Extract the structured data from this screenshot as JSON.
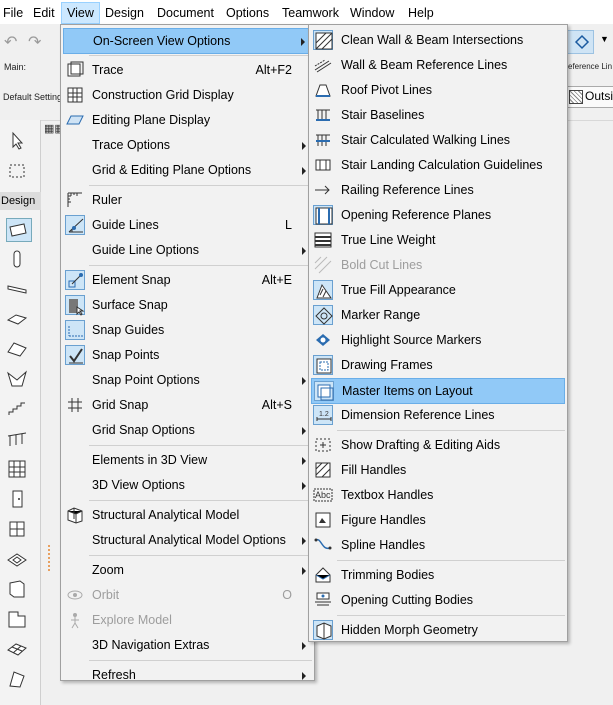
{
  "menubar": [
    "File",
    "Edit",
    "View",
    "Design",
    "Document",
    "Options",
    "Teamwork",
    "Window",
    "Help"
  ],
  "toolbar": {
    "main_label": "Main:",
    "default_settings": "Default Setting",
    "right_label": "eference Lin",
    "outside_label": "Outsi"
  },
  "toolbox": {
    "design_tab": "Design"
  },
  "view_menu": [
    {
      "label": "On-Screen View Options",
      "submenu": true,
      "highlighted": true
    },
    {
      "sep": true
    },
    {
      "label": "Trace",
      "shortcut": "Alt+F2",
      "icon": "trace-icon"
    },
    {
      "label": "Construction Grid Display",
      "icon": "grid-icon"
    },
    {
      "label": "Editing Plane Display",
      "icon": "editing-plane-icon"
    },
    {
      "label": "Trace Options",
      "submenu": true
    },
    {
      "label": "Grid & Editing Plane Options",
      "submenu": true
    },
    {
      "sep": true
    },
    {
      "label": "Ruler",
      "icon": "ruler-icon"
    },
    {
      "label": "Guide Lines",
      "shortcut": "L",
      "icon": "guide-lines-icon",
      "checked": true
    },
    {
      "label": "Guide Line Options",
      "submenu": true
    },
    {
      "sep": true
    },
    {
      "label": "Element Snap",
      "shortcut": "Alt+E",
      "icon": "element-snap-icon",
      "checked": true
    },
    {
      "label": "Surface Snap",
      "icon": "surface-snap-icon",
      "checked": true
    },
    {
      "label": "Snap Guides",
      "icon": "snap-guides-icon",
      "checked": true
    },
    {
      "label": "Snap Points",
      "icon": "snap-points-icon",
      "checked": true
    },
    {
      "label": "Snap Point Options",
      "submenu": true
    },
    {
      "label": "Grid Snap",
      "shortcut": "Alt+S",
      "icon": "grid-snap-icon"
    },
    {
      "label": "Grid Snap Options",
      "submenu": true
    },
    {
      "sep": true
    },
    {
      "label": "Elements in 3D View",
      "submenu": true
    },
    {
      "label": "3D View Options",
      "submenu": true
    },
    {
      "sep": true
    },
    {
      "label": "Structural Analytical Model",
      "icon": "structural-model-icon"
    },
    {
      "label": "Structural Analytical Model Options",
      "submenu": true
    },
    {
      "sep": true
    },
    {
      "label": "Zoom",
      "submenu": true
    },
    {
      "label": "Orbit",
      "shortcut": "O",
      "icon": "orbit-icon",
      "disabled": true
    },
    {
      "label": "Explore Model",
      "icon": "explore-icon",
      "disabled": true
    },
    {
      "label": "3D Navigation Extras",
      "submenu": true
    },
    {
      "sep": true
    },
    {
      "label": "Refresh",
      "submenu": true
    }
  ],
  "submenu": [
    {
      "label": "Clean Wall & Beam Intersections",
      "icon": "clean-intersections-icon",
      "checked": true
    },
    {
      "label": "Wall & Beam Reference Lines",
      "icon": "reference-lines-icon"
    },
    {
      "label": "Roof Pivot Lines",
      "icon": "roof-pivot-icon"
    },
    {
      "label": "Stair Baselines",
      "icon": "stair-baselines-icon"
    },
    {
      "label": "Stair Calculated Walking Lines",
      "icon": "walking-lines-icon"
    },
    {
      "label": "Stair Landing Calculation Guidelines",
      "icon": "landing-guidelines-icon"
    },
    {
      "label": "Railing Reference Lines",
      "icon": "railing-lines-icon"
    },
    {
      "label": "Opening Reference Planes",
      "icon": "opening-planes-icon",
      "checked": true
    },
    {
      "label": "True Line Weight",
      "icon": "line-weight-icon"
    },
    {
      "label": "Bold Cut Lines",
      "icon": "bold-cut-icon",
      "disabled": true
    },
    {
      "label": "True Fill Appearance",
      "icon": "fill-appearance-icon",
      "checked": true
    },
    {
      "label": "Marker Range",
      "icon": "marker-range-icon",
      "checked": true
    },
    {
      "label": "Highlight Source Markers",
      "icon": "source-markers-icon"
    },
    {
      "label": "Drawing Frames",
      "icon": "drawing-frames-icon",
      "checked": true
    },
    {
      "label": "Master Items on Layout",
      "icon": "master-items-icon",
      "checked": true,
      "highlighted": true
    },
    {
      "label": "Dimension Reference Lines",
      "icon": "dimension-lines-icon",
      "checked": true
    },
    {
      "sep": true
    },
    {
      "label": "Show Drafting & Editing Aids",
      "icon": "drafting-aids-icon"
    },
    {
      "label": "Fill Handles",
      "icon": "fill-handles-icon"
    },
    {
      "label": "Textbox Handles",
      "icon": "textbox-handles-icon"
    },
    {
      "label": "Figure Handles",
      "icon": "figure-handles-icon"
    },
    {
      "label": "Spline Handles",
      "icon": "spline-handles-icon"
    },
    {
      "sep": true
    },
    {
      "label": "Trimming Bodies",
      "icon": "trimming-bodies-icon"
    },
    {
      "label": "Opening Cutting Bodies",
      "icon": "cutting-bodies-icon"
    },
    {
      "sep": true
    },
    {
      "label": "Hidden Morph Geometry",
      "icon": "morph-geometry-icon",
      "checked": true
    }
  ]
}
